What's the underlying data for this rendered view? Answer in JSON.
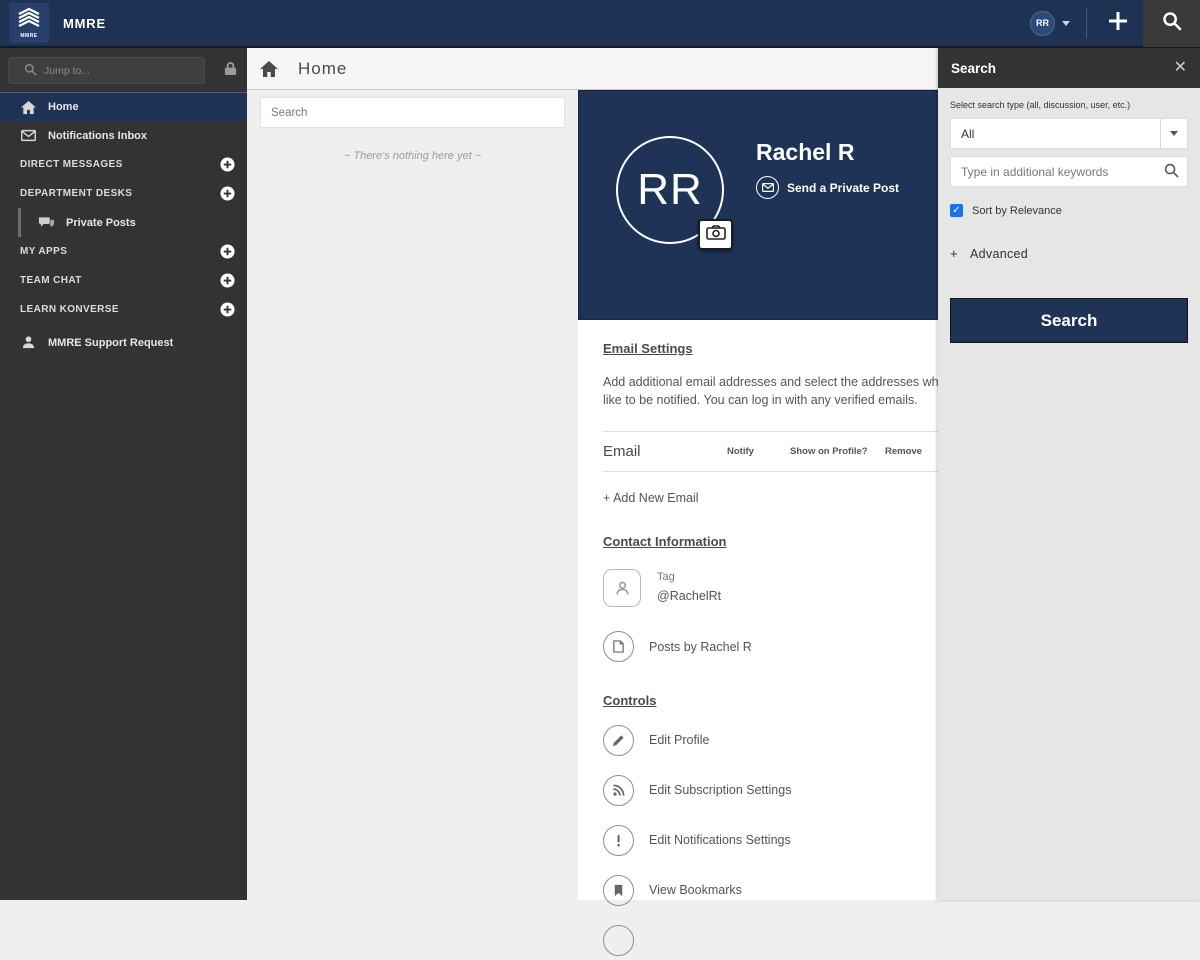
{
  "colors": {
    "topbar_navy": "#1e3253",
    "card_navy": "#1e3355",
    "sidebar_gray": "#333333",
    "checkbox_blue": "#1a73e8"
  },
  "topbar": {
    "logo_word": "MMRE",
    "brand": "MMRE",
    "user_initials": "RR"
  },
  "sidebar": {
    "jump_placeholder": "Jump to...",
    "items": [
      {
        "label": "Home"
      },
      {
        "label": "Notifications Inbox"
      },
      {
        "label": "DIRECT MESSAGES"
      },
      {
        "label": "DEPARTMENT DESKS"
      },
      {
        "label": "Private Posts"
      },
      {
        "label": "MY APPS"
      },
      {
        "label": "TEAM CHAT"
      },
      {
        "label": "LEARN KONVERSE"
      },
      {
        "label": "MMRE Support Request"
      }
    ]
  },
  "main": {
    "page_title": "Home",
    "feed": {
      "search_placeholder": "Search",
      "empty_text": "~ There's nothing here yet ~"
    }
  },
  "profile": {
    "initials": "RR",
    "name": "Rachel R",
    "send_private_post": "Send a Private Post",
    "email_settings": {
      "heading": "Email Settings",
      "description": "Add additional email addresses and select the addresses where you would like to be notified. You can log in with any verified emails.",
      "headers": {
        "email": "Email",
        "notify": "Notify",
        "show": "Show on Profile?",
        "remove": "Remove"
      },
      "add_new_email": "+ Add New Email"
    },
    "contact": {
      "heading": "Contact Information",
      "tag_label": "Tag",
      "tag_value": "@RachelRt",
      "posts_link": "Posts by Rachel R"
    },
    "controls": {
      "heading": "Controls",
      "items": [
        "Edit Profile",
        "Edit Subscription Settings",
        "Edit Notifications Settings",
        "View Bookmarks"
      ]
    }
  },
  "search_panel": {
    "title": "Search",
    "type_label": "Select search type (all, discussion, user, etc.)",
    "type_value": "All",
    "keywords_placeholder": "Type in additional keywords",
    "sort_label": "Sort by Relevance",
    "advanced_label": "Advanced",
    "button_label": "Search"
  }
}
